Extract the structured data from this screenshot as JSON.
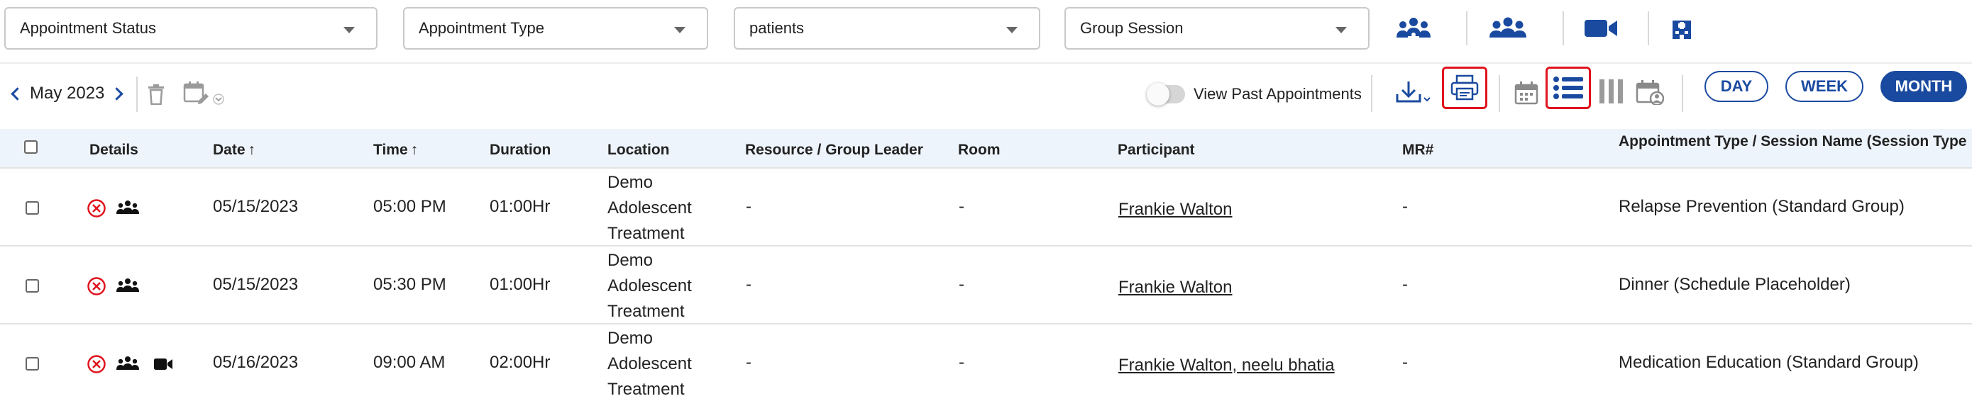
{
  "filters": {
    "appointment_status": "Appointment Status",
    "appointment_type": "Appointment Type",
    "patients": "patients",
    "group_session": "Group Session"
  },
  "view_icons": [
    "users-gear-icon",
    "users-icon",
    "video-camera-icon",
    "hospital-icon"
  ],
  "toolbar": {
    "month": "May 2023",
    "past_label": "View Past Appointments",
    "views": {
      "day": "DAY",
      "week": "WEEK",
      "month": "MONTH"
    },
    "active_view": "MONTH"
  },
  "colors": {
    "accent": "#1a4aa0",
    "highlight": "#e0141e",
    "cancel": "#e0141e",
    "header_bg": "#eef4fb"
  },
  "table": {
    "headers": {
      "details": "Details",
      "date": "Date",
      "time": "Time",
      "duration": "Duration",
      "location": "Location",
      "resource": "Resource / Group Leader",
      "room": "Room",
      "participant": "Participant",
      "mr": "MR#",
      "appt_type": "Appointment Type / Session Name (Session Type"
    },
    "sort_arrow": "↑",
    "rows": [
      {
        "date": "05/15/2023",
        "time": "05:00 PM",
        "duration": "01:00Hr",
        "location": [
          "Demo",
          "Adolescent",
          "Treatment"
        ],
        "resource": "-",
        "room": "-",
        "participant": "Frankie Walton",
        "mr": "-",
        "appt_type": "Relapse Prevention (Standard Group)"
      },
      {
        "date": "05/15/2023",
        "time": "05:30 PM",
        "duration": "01:00Hr",
        "location": [
          "Demo",
          "Adolescent",
          "Treatment"
        ],
        "resource": "-",
        "room": "-",
        "participant": "Frankie Walton",
        "mr": "-",
        "appt_type": "Dinner (Schedule Placeholder)"
      },
      {
        "date": "05/16/2023",
        "time": "09:00 AM",
        "duration": "02:00Hr",
        "location": [
          "Demo",
          "Adolescent",
          "Treatment"
        ],
        "resource": "-",
        "room": "-",
        "participant": "Frankie Walton, neelu bhatia",
        "mr": "-",
        "appt_type": "Medication Education (Standard Group)"
      }
    ]
  }
}
